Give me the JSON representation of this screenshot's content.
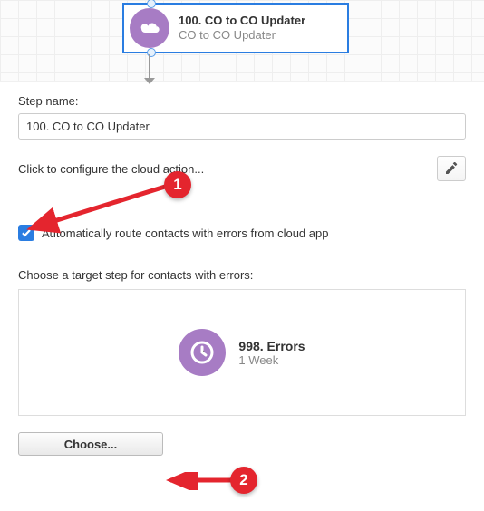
{
  "canvas_node": {
    "title": "100. CO to CO Updater",
    "subtitle": "CO to CO Updater",
    "icon": "cloud-icon"
  },
  "form": {
    "step_name_label": "Step name:",
    "step_name_value": "100. CO to CO Updater",
    "configure_text": "Click to configure the cloud action...",
    "edit_icon": "pencil-icon",
    "auto_route_label": "Automatically route contacts with errors from cloud app",
    "auto_route_checked": true,
    "target_label": "Choose a target step for contacts with errors:",
    "choose_button": "Choose..."
  },
  "target_step": {
    "title": "998. Errors",
    "subtitle": "1 Week",
    "icon": "clock-icon"
  },
  "annotations": {
    "callout1": "1",
    "callout2": "2"
  },
  "colors": {
    "accent_purple": "#a77cc4",
    "accent_blue": "#2a7de1",
    "annotation_red": "#e4252e"
  }
}
